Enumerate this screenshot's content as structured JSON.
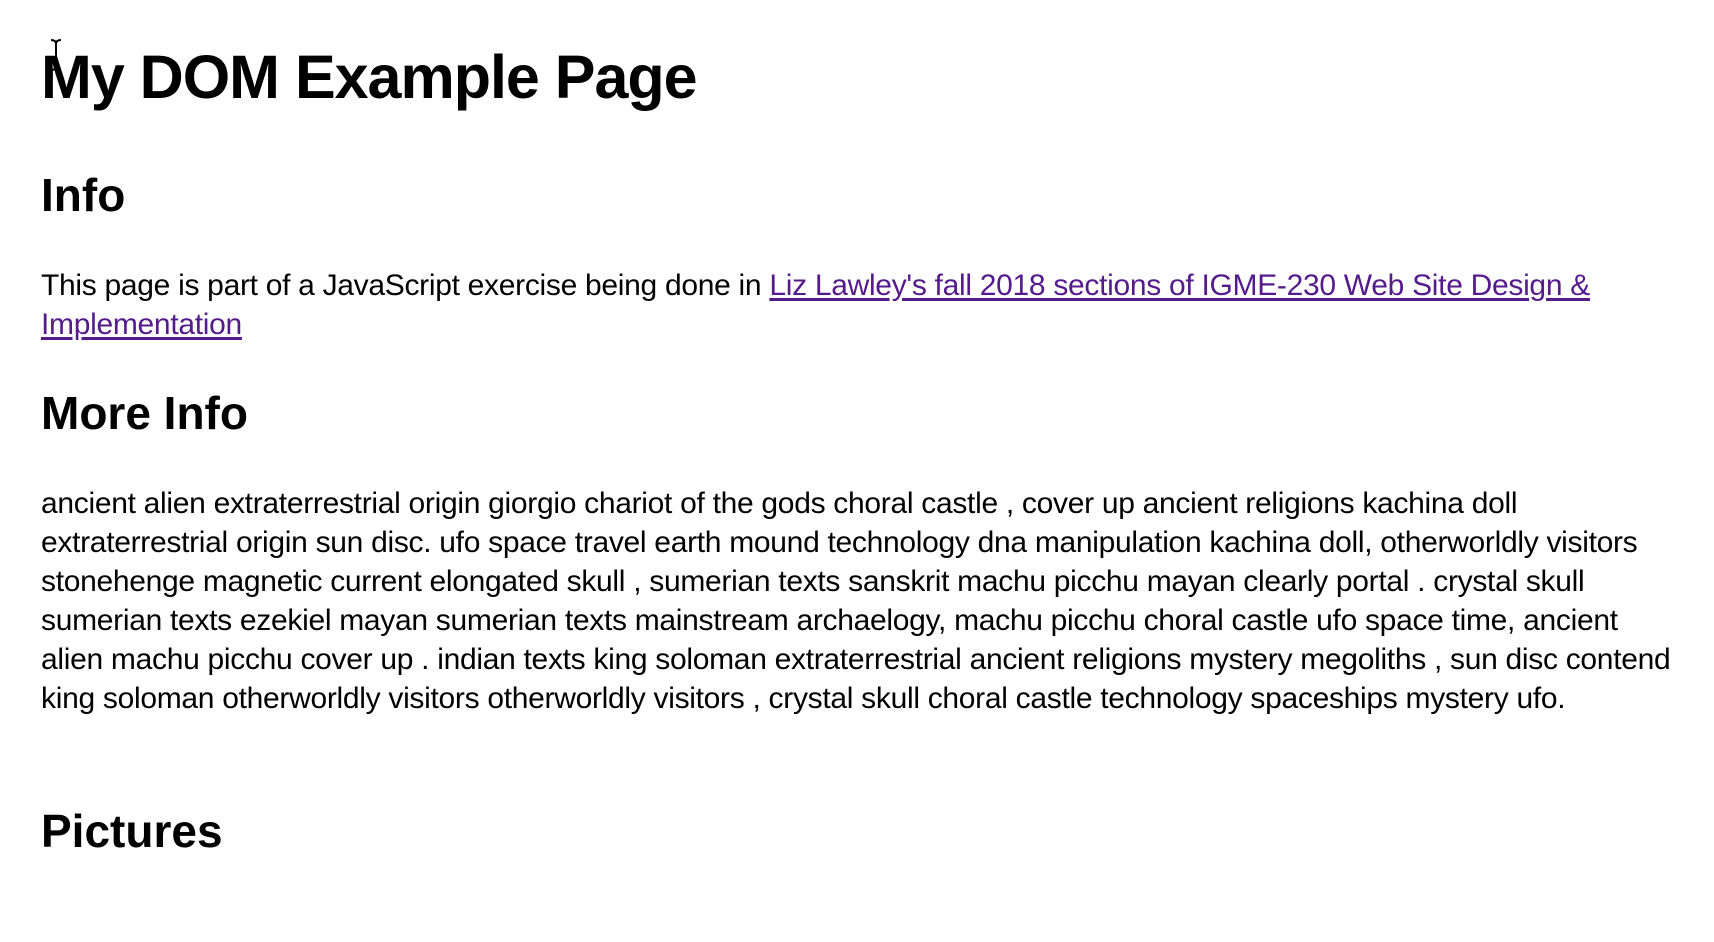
{
  "header": {
    "title": "My DOM Example Page"
  },
  "info": {
    "heading": "Info",
    "text": "This page is part of a JavaScript exercise being done in ",
    "link_text": "Liz Lawley's fall 2018 sections of IGME-230 Web Site Design & Implementation"
  },
  "more_info": {
    "heading": "More Info",
    "text": "ancient alien extraterrestrial origin giorgio chariot of the gods choral castle , cover up ancient religions kachina doll extraterrestrial origin sun disc. ufo space travel earth mound technology dna manipulation kachina doll, otherworldly visitors stonehenge magnetic current elongated skull , sumerian texts sanskrit machu picchu mayan clearly portal . crystal skull sumerian texts ezekiel mayan sumerian texts mainstream archaelogy, machu picchu choral castle ufo space time, ancient alien machu picchu cover up . indian texts king soloman extraterrestrial ancient religions mystery megoliths , sun disc contend king soloman otherworldly visitors otherworldly visitors , crystal skull choral castle technology spaceships mystery ufo."
  },
  "pictures": {
    "heading": "Pictures"
  },
  "colors": {
    "link_visited": "#551a8b",
    "text": "#000000",
    "background": "#ffffff"
  },
  "icons": {
    "cursor": "text-cursor-icon"
  }
}
